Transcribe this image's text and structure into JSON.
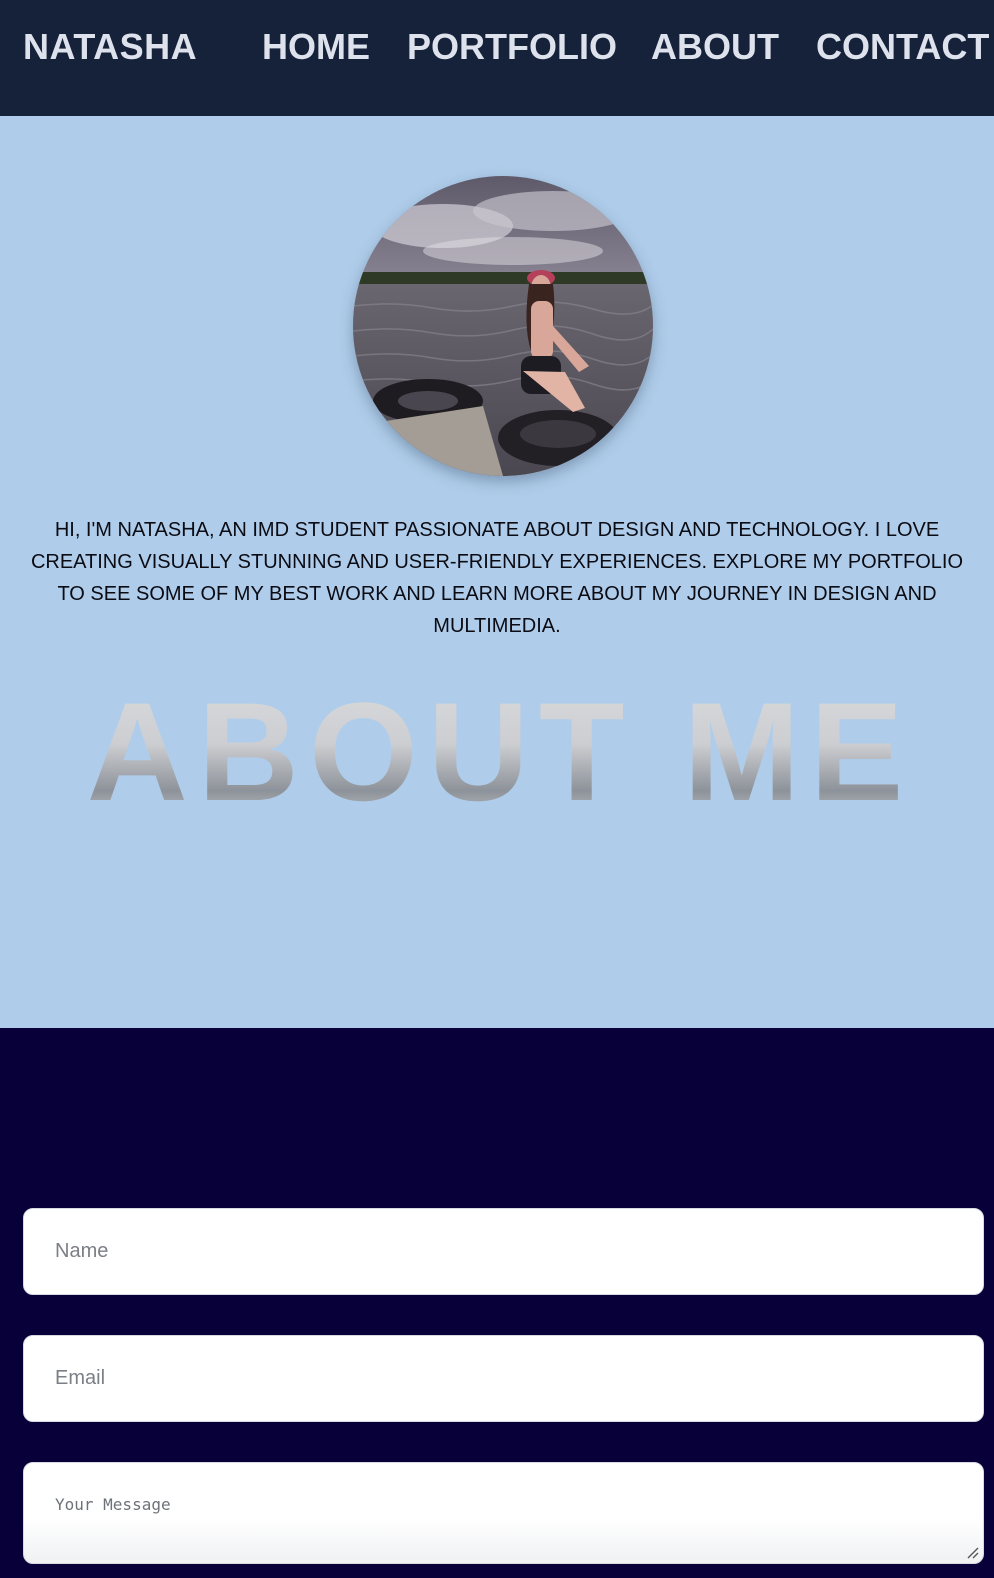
{
  "header": {
    "brand": "NATASHA",
    "nav": [
      {
        "label": "HOME"
      },
      {
        "label": "PORTFOLIO"
      },
      {
        "label": "ABOUT"
      },
      {
        "label": "CONTACT"
      }
    ]
  },
  "hero": {
    "profile_image": "profile-photo",
    "intro": "HI, I'M NATASHA, AN IMD STUDENT PASSIONATE ABOUT DESIGN AND TECHNOLOGY. I LOVE CREATING VISUALLY STUNNING AND USER-FRIENDLY EXPERIENCES. EXPLORE MY PORTFOLIO TO SEE SOME OF MY BEST WORK AND LEARN MORE ABOUT MY JOURNEY IN DESIGN AND MULTIMEDIA.",
    "heading": "ABOUT ME"
  },
  "contact_form": {
    "name_placeholder": "Name",
    "email_placeholder": "Email",
    "message_placeholder": "Your Message"
  },
  "colors": {
    "nav_bg": "#16213a",
    "nav_text": "#dde2ec",
    "hero_bg": "#afcdea",
    "contact_bg": "#080038"
  }
}
